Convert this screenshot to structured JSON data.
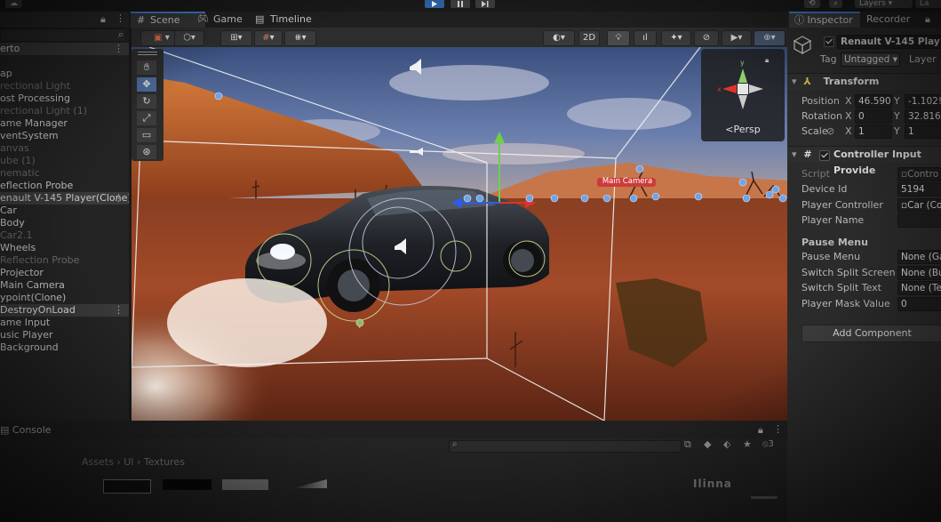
{
  "hierarchy": {
    "scene_name": "erto",
    "items": [
      {
        "label": "ap",
        "style": "normal"
      },
      {
        "label": "rectional Light",
        "style": "dim"
      },
      {
        "label": "ost Processing",
        "style": "normal"
      },
      {
        "label": "rectional Light (1)",
        "style": "dim"
      },
      {
        "label": "ame Manager",
        "style": "normal"
      },
      {
        "label": "ventSystem",
        "style": "normal"
      },
      {
        "label": "anvas",
        "style": "dim"
      },
      {
        "label": "ube (1)",
        "style": "dim"
      },
      {
        "label": "nematic",
        "style": "dim"
      },
      {
        "label": "eflection Probe",
        "style": "normal"
      },
      {
        "label": "enault V-145 Player(Clone)",
        "style": "selected"
      },
      {
        "label": "Car",
        "style": "normal"
      },
      {
        "label": "Body",
        "style": "normal"
      },
      {
        "label": "Car2.1",
        "style": "dim"
      },
      {
        "label": "Wheels",
        "style": "normal"
      },
      {
        "label": "Reflection Probe",
        "style": "dim"
      },
      {
        "label": "Projector",
        "style": "normal"
      },
      {
        "label": "Main Camera",
        "style": "normal"
      },
      {
        "label": "ypoint(Clone)",
        "style": "normal"
      },
      {
        "label": "DestroyOnLoad",
        "style": "scene"
      },
      {
        "label": "ame Input",
        "style": "normal"
      },
      {
        "label": "usic Player",
        "style": "normal"
      },
      {
        "label": "Background",
        "style": "normal"
      }
    ]
  },
  "scene_tabs": [
    {
      "label": "Scene",
      "icon": "hash-icon"
    },
    {
      "label": "Game",
      "icon": "gamepad-icon"
    },
    {
      "label": "Timeline",
      "icon": "timeline-icon"
    }
  ],
  "scene_toolbar": {
    "mode_2d": "2D",
    "persp_label": "Persp"
  },
  "viewport": {
    "camera_label": "Main Camera"
  },
  "toolbar_right": {
    "layers": "Layers",
    "layout": "La"
  },
  "inspector": {
    "tabs": [
      "Inspector",
      "Recorder"
    ],
    "object_name": "Renault V-145 Play",
    "tag_label": "Tag",
    "tag_value": "Untagged",
    "layer_label": "Layer",
    "transform": {
      "title": "Transform",
      "position_label": "Position",
      "rotation_label": "Rotation",
      "scale_label": "Scale",
      "position": {
        "x": "46.590",
        "y": "-1.102!"
      },
      "rotation": {
        "x": "0",
        "y": "32.816"
      },
      "scale": {
        "x": "1",
        "y": "1"
      }
    },
    "controller": {
      "title": "Controller Input Provide",
      "script_label": "Script",
      "script_value": "Contro",
      "device_id_label": "Device Id",
      "device_id": "5194",
      "player_controller_label": "Player Controller",
      "player_controller_value": "Car (Co",
      "player_name_label": "Player Name",
      "player_name_value": "",
      "pause_header": "Pause Menu",
      "pause_menu_label": "Pause Menu",
      "pause_menu_value": "None (Ga",
      "switch_split_screen_label": "Switch Split Screen B",
      "switch_split_screen_value": "None (Bu",
      "switch_split_text_label": "Switch Split Text",
      "switch_split_text_value": "None (Te",
      "player_mask_label": "Player Mask Value",
      "player_mask_value": "0"
    },
    "add_component": "Add Component"
  },
  "console": {
    "tab_label": "Console",
    "breadcrumb": [
      "Assets",
      "UI",
      "Textures"
    ],
    "count": "3",
    "thumb_label": "Ilinna"
  }
}
